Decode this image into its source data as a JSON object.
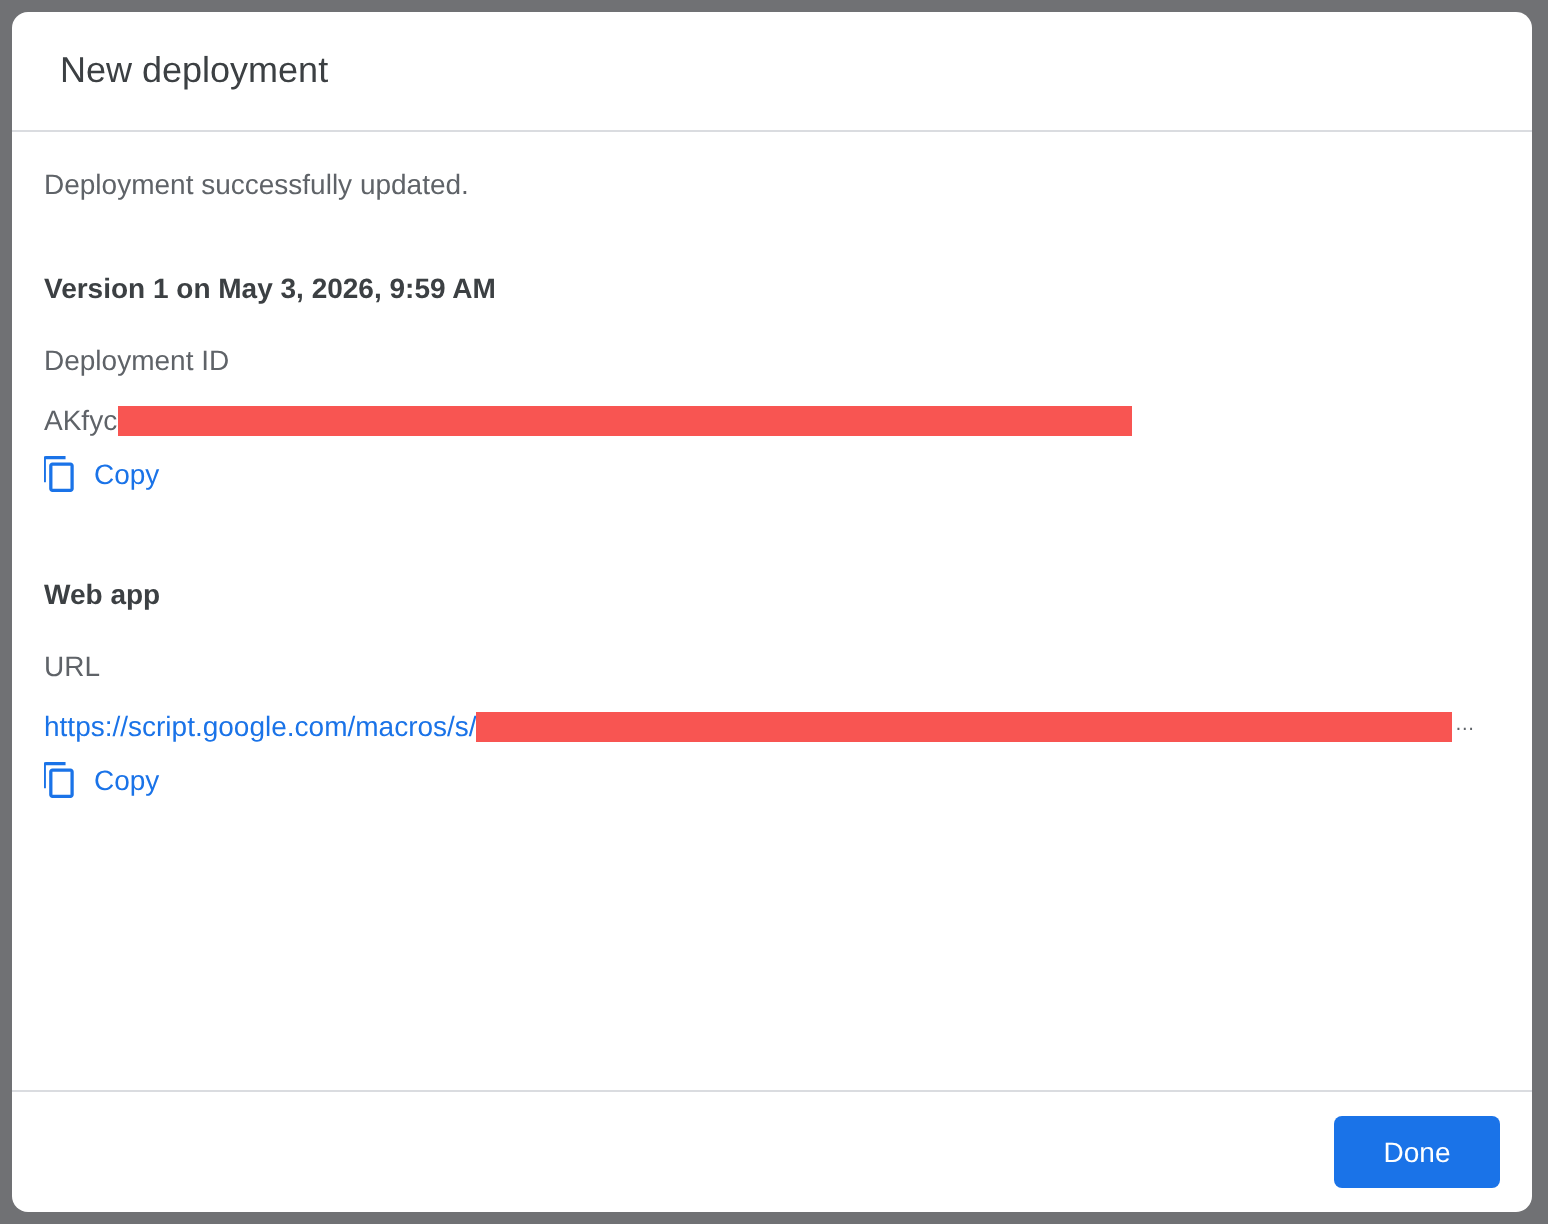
{
  "dialog": {
    "title": "New deployment",
    "message": "Deployment successfully updated.",
    "version_heading": "Version 1 on May 3, 2026, 9:59 AM",
    "deployment_id": {
      "label": "Deployment ID",
      "value": "AKfyc",
      "redacted": true,
      "copy_label": "Copy"
    },
    "web_app": {
      "heading": "Web app",
      "url_label": "URL",
      "url": "https://script.google.com/macros/s/",
      "redacted": true,
      "url_suffix": "…",
      "copy_label": "Copy"
    },
    "buttons": [
      {
        "label": "Done",
        "kind": "primary"
      }
    ]
  }
}
